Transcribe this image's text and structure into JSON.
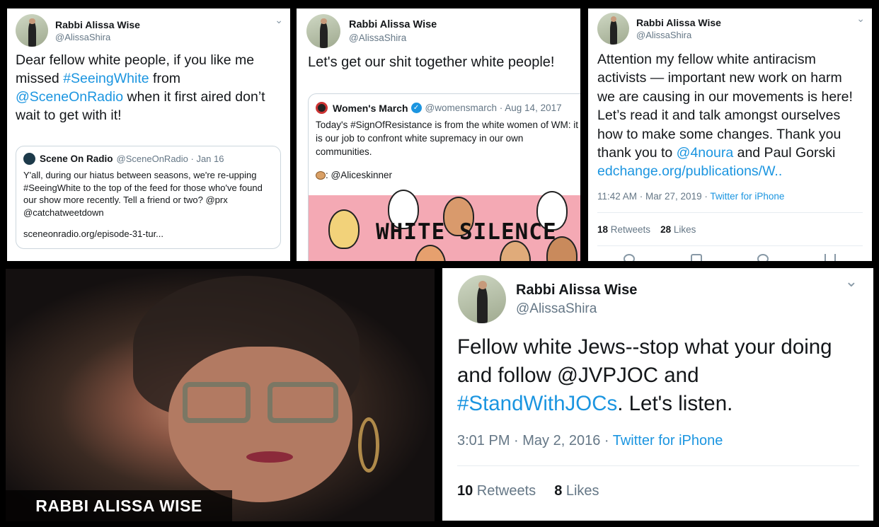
{
  "p1": {
    "name": "Rabbi Alissa Wise",
    "handle": "@AlissaShira",
    "text_1": "Dear fellow white people, if you like me missed ",
    "tag": "#SeeingWhite",
    "text_2": " from ",
    "mention": "@SceneOnRadio",
    "text_3": " when it first aired don’t wait to get with it!",
    "quote": {
      "name": "Scene On Radio",
      "handle_date": "@SceneOnRadio · Jan 16",
      "text": "Y'all, during our hiatus between seasons, we're re-upping #SeeingWhite to the top of the feed for those who've found our show more recently. Tell a friend or two?  @prx @catchatweetdown",
      "link": "sceneonradio.org/episode-31-tur..."
    }
  },
  "p2": {
    "name": "Rabbi Alissa Wise",
    "handle": "@AlissaShira",
    "text": "Let's get our shit together white people!",
    "quote": {
      "name": "Women's March",
      "handle_date": "@womensmarch · Aug 14, 2017",
      "text": "Today's #SignOfResistance is from the white women of WM: it is our job to confront white supremacy in our own communities.",
      "credit": ": @Aliceskinner",
      "image_text": "WHITE SILENCE"
    }
  },
  "p3": {
    "name": "Rabbi Alissa Wise",
    "handle": "@AlissaShira",
    "text_1": "Attention my fellow white antiracism activists — important new work on harm we are causing in our movements is here! Let’s read it and talk amongst ourselves how to make some changes. Thank you thank you to ",
    "mention": "@4noura",
    "text_2": " and Paul Gorski ",
    "link": "edchange.org/publications/W..",
    "time": "11:42 AM · Mar 27, 2019 · ",
    "source": "Twitter for iPhone",
    "retweets": "18",
    "retweets_label": " Retweets",
    "likes": "28",
    "likes_label": " Likes"
  },
  "p4": {
    "caption": "RABBI ALISSA WISE"
  },
  "p5": {
    "name": "Rabbi Alissa Wise",
    "handle": "@AlissaShira",
    "text_1": "Fellow white Jews--stop what your doing and follow @JVPJOC and ",
    "tag": "#StandWithJOCs",
    "text_2": ". Let's listen.",
    "time": "3:01 PM · May 2, 2016 · ",
    "source": "Twitter for iPhone",
    "retweets": "10",
    "retweets_label": " Retweets",
    "likes": "8",
    "likes_label": " Likes"
  },
  "icons": {
    "chevron": "chevron-down-icon",
    "verified": "verified-badge-icon",
    "reply": "reply-icon",
    "retweet": "retweet-icon",
    "like": "heart-icon",
    "share": "share-icon"
  },
  "colors": {
    "link": "#1b95e0",
    "background": "#000000",
    "illustration_bg": "#f4a9b4"
  }
}
